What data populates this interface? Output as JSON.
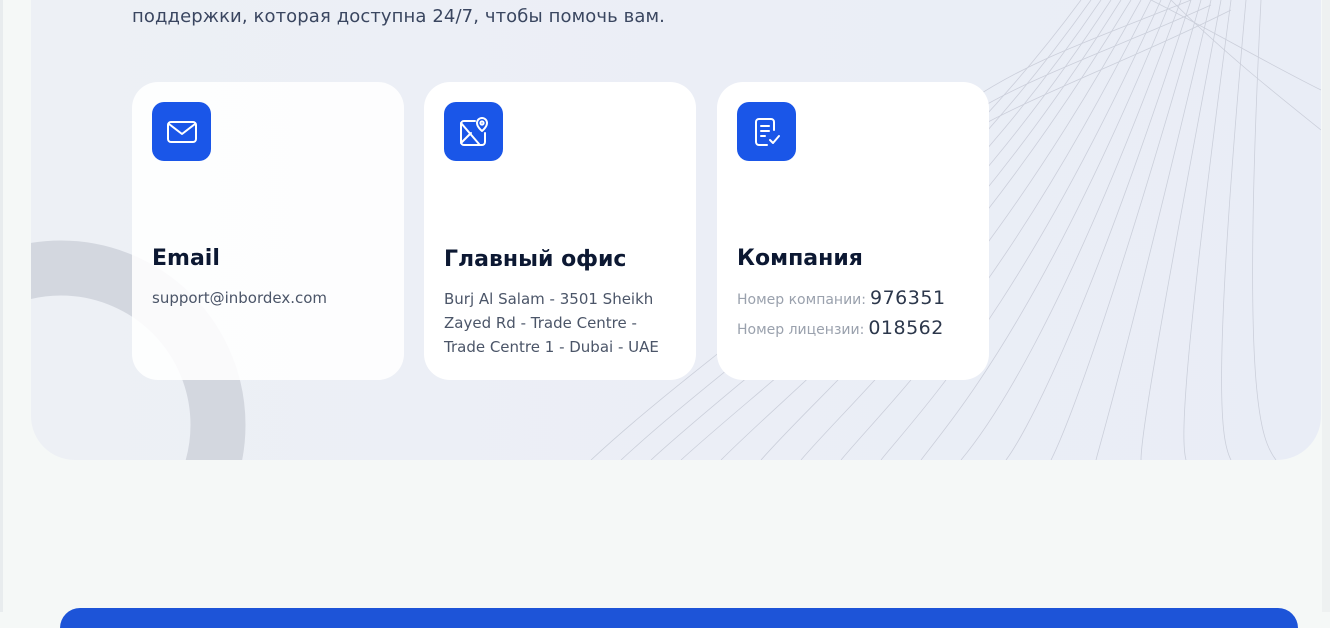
{
  "intro_text": "поддержки, которая доступна 24/7, чтобы помочь вам.",
  "cards": [
    {
      "icon": "mail-icon",
      "title": "Email",
      "text": "support@inbordex.com"
    },
    {
      "icon": "map-pin-icon",
      "title": "Главный офис",
      "text": "Burj Al Salam - 3501 Sheikh Zayed Rd - Trade Centre - Trade Centre 1 - Dubai - UAE"
    },
    {
      "icon": "document-check-icon",
      "title": "Компания",
      "company_number_label": "Номер компании:",
      "company_number": "976351",
      "license_number_label": "Номер лицензии:",
      "license_number": "018562"
    }
  ],
  "colors": {
    "accent": "#1a56e8",
    "section_bg": "#edf0f5",
    "page_bg": "#f5f8f7",
    "bottom_bar": "#1d54d8"
  }
}
